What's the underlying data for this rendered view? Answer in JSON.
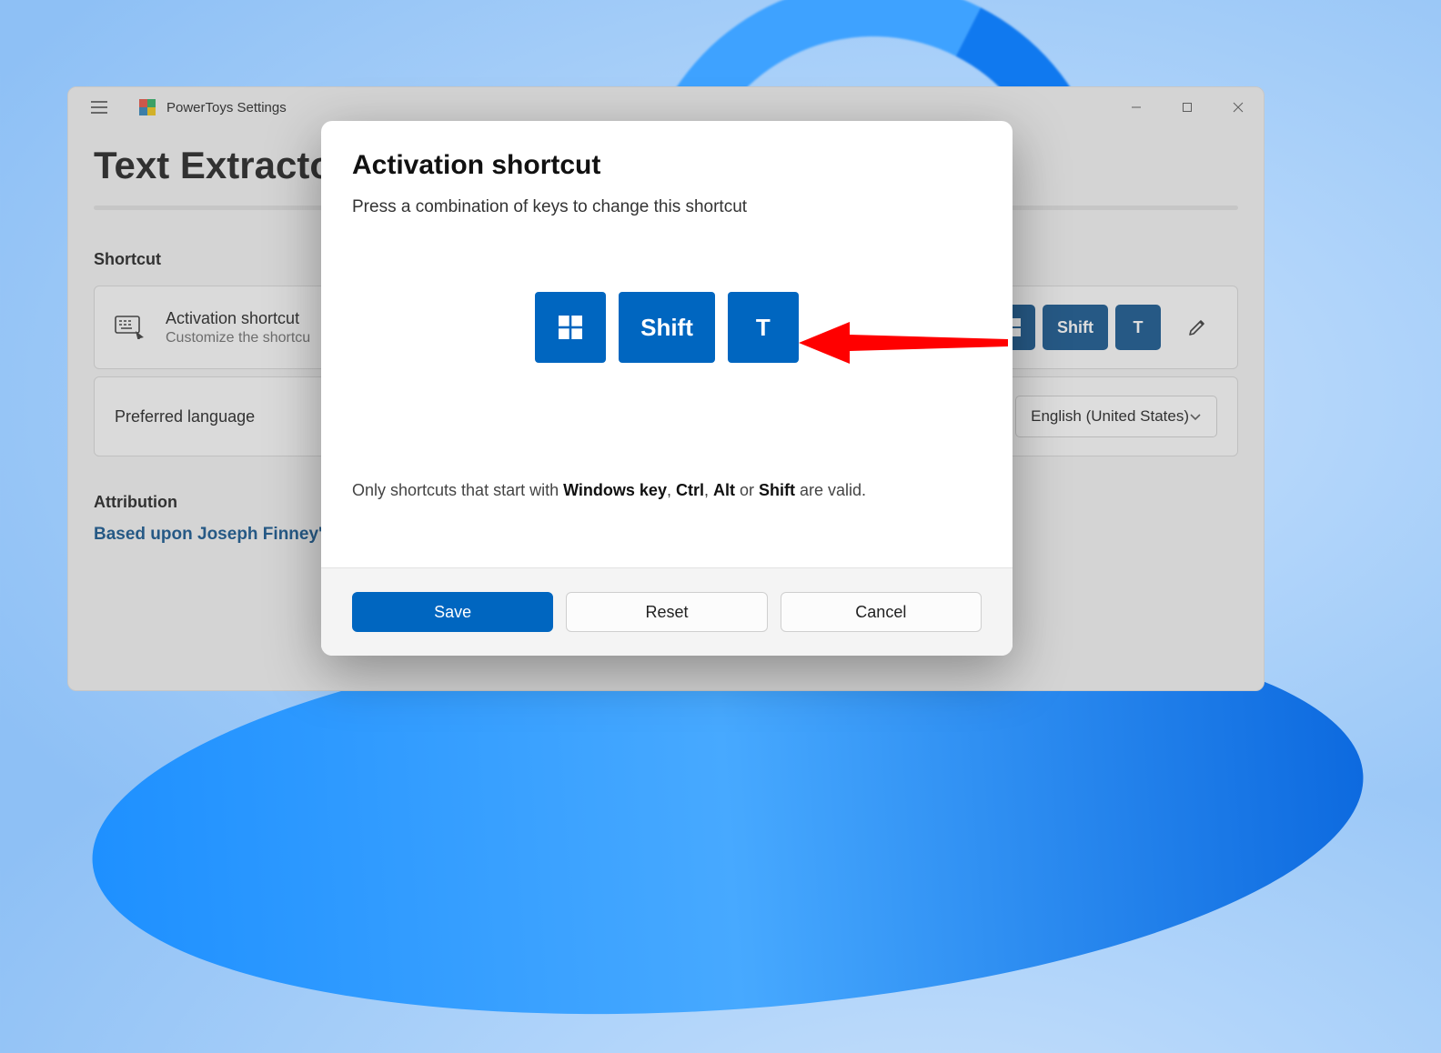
{
  "titlebar": {
    "app_title": "PowerToys Settings"
  },
  "page": {
    "title": "Text Extractor",
    "section_shortcut": "Shortcut",
    "card_shortcut": {
      "title": "Activation shortcut",
      "sub": "Customize the shortcu",
      "keys": [
        "",
        "Shift",
        "T"
      ]
    },
    "card_lang": {
      "title": "Preferred language",
      "value": "English (United States)"
    },
    "attribution_label": "Attribution",
    "attribution_link": "Based upon Joseph Finney's"
  },
  "modal": {
    "title": "Activation shortcut",
    "subtitle": "Press a combination of keys to change this shortcut",
    "keys": [
      "win",
      "Shift",
      "T"
    ],
    "hint_prefix": "Only shortcuts that start with ",
    "hint_k1": "Windows key",
    "hint_c1": ", ",
    "hint_k2": "Ctrl",
    "hint_c2": ", ",
    "hint_k3": "Alt",
    "hint_c3": " or ",
    "hint_k4": "Shift",
    "hint_suffix": " are valid.",
    "save": "Save",
    "reset": "Reset",
    "cancel": "Cancel"
  }
}
